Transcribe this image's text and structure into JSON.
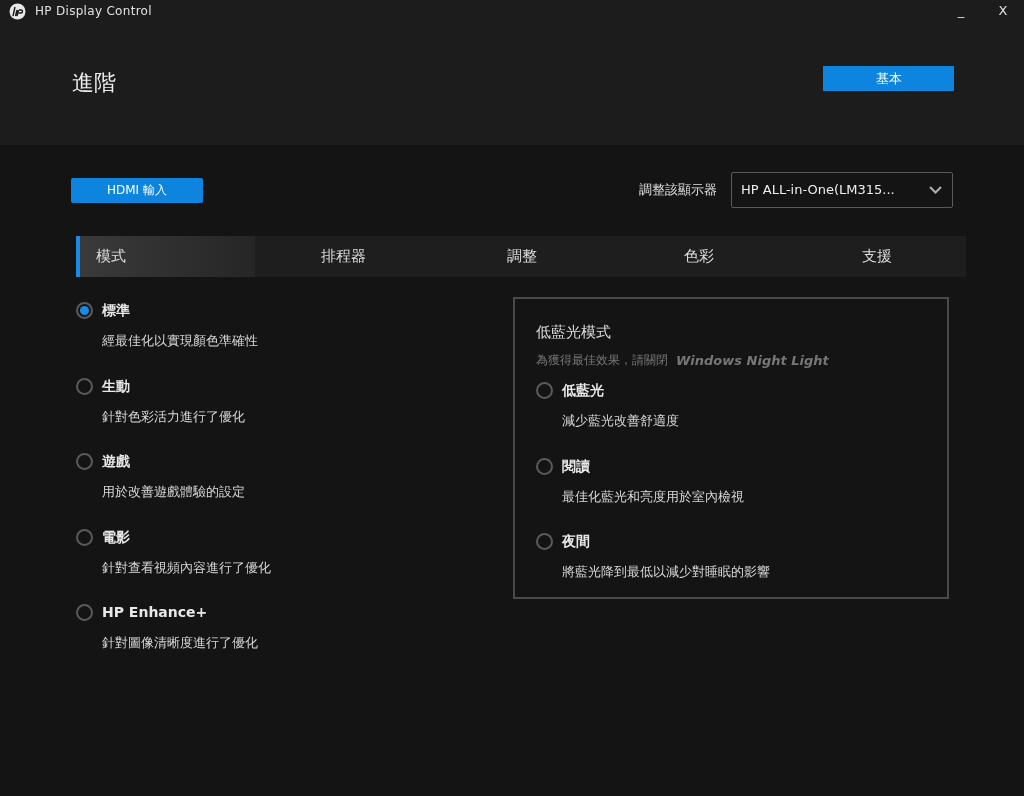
{
  "window": {
    "title": "HP Display Control",
    "controls": [
      "_",
      "X"
    ]
  },
  "header": {
    "title": "進階",
    "button": "基本"
  },
  "input_button": "HDMI 輸入",
  "monitor_select": {
    "label": "調整該顯示器",
    "value": "HP ALL-in-One(LM315..."
  },
  "tabs": [
    {
      "label": "模式",
      "selected": true
    },
    {
      "label": "排程器",
      "selected": false
    },
    {
      "label": "調整",
      "selected": false
    },
    {
      "label": "色彩",
      "selected": false
    },
    {
      "label": "支援",
      "selected": false
    }
  ],
  "modes": [
    {
      "label": "標準",
      "description": "經最佳化以實現顏色準確性",
      "selected": true
    },
    {
      "label": "生動",
      "description": "針對色彩活力進行了優化",
      "selected": false
    },
    {
      "label": "遊戲",
      "description": "用於改善遊戲體驗的設定",
      "selected": false
    },
    {
      "label": "電影",
      "description": "針對查看視頻內容進行了優化",
      "selected": false
    },
    {
      "label": "HP Enhance+",
      "description": "針對圖像清晰度進行了優化",
      "selected": false
    }
  ],
  "low_blue_light": {
    "title": "低藍光模式",
    "hint": "為獲得最佳效果，請關閉",
    "hint_emphasis": "Windows Night Light",
    "options": [
      {
        "label": "低藍光",
        "description": "減少藍光改善舒適度",
        "selected": false
      },
      {
        "label": "閱讀",
        "description": "最佳化藍光和亮度用於室內檢視",
        "selected": false
      },
      {
        "label": "夜間",
        "description": "將藍光降到最低以減少對睡眠的影響",
        "selected": false
      }
    ]
  }
}
